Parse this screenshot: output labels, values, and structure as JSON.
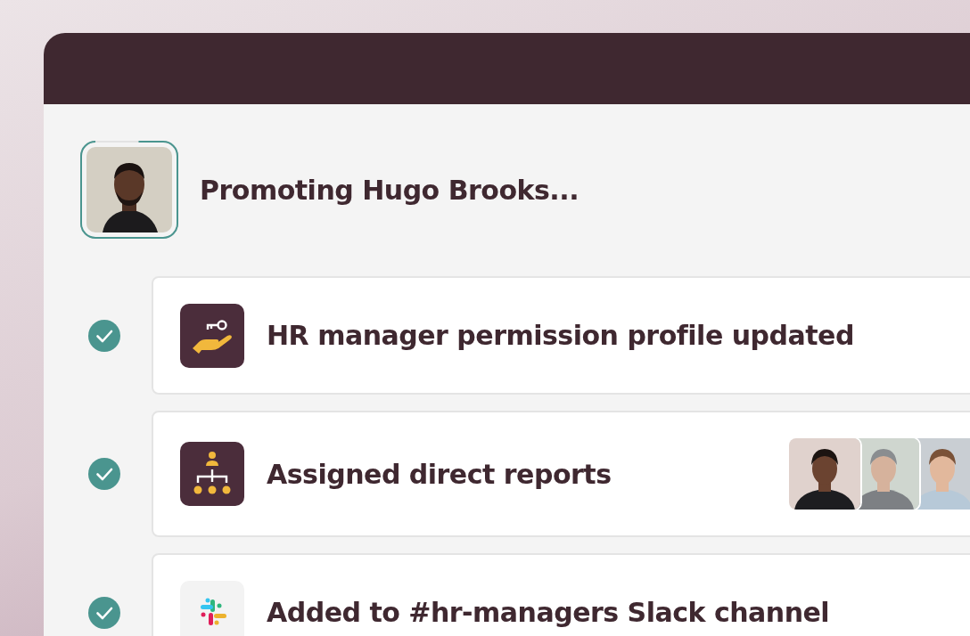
{
  "promotion": {
    "title": "Promoting Hugo Brooks..."
  },
  "steps": [
    {
      "kind": "permission",
      "text": "HR manager permission profile updated",
      "done": true
    },
    {
      "kind": "reports",
      "text": "Assigned direct reports",
      "done": true
    },
    {
      "kind": "slack",
      "text": "Added to #hr-managers Slack channel",
      "done": true
    }
  ]
}
